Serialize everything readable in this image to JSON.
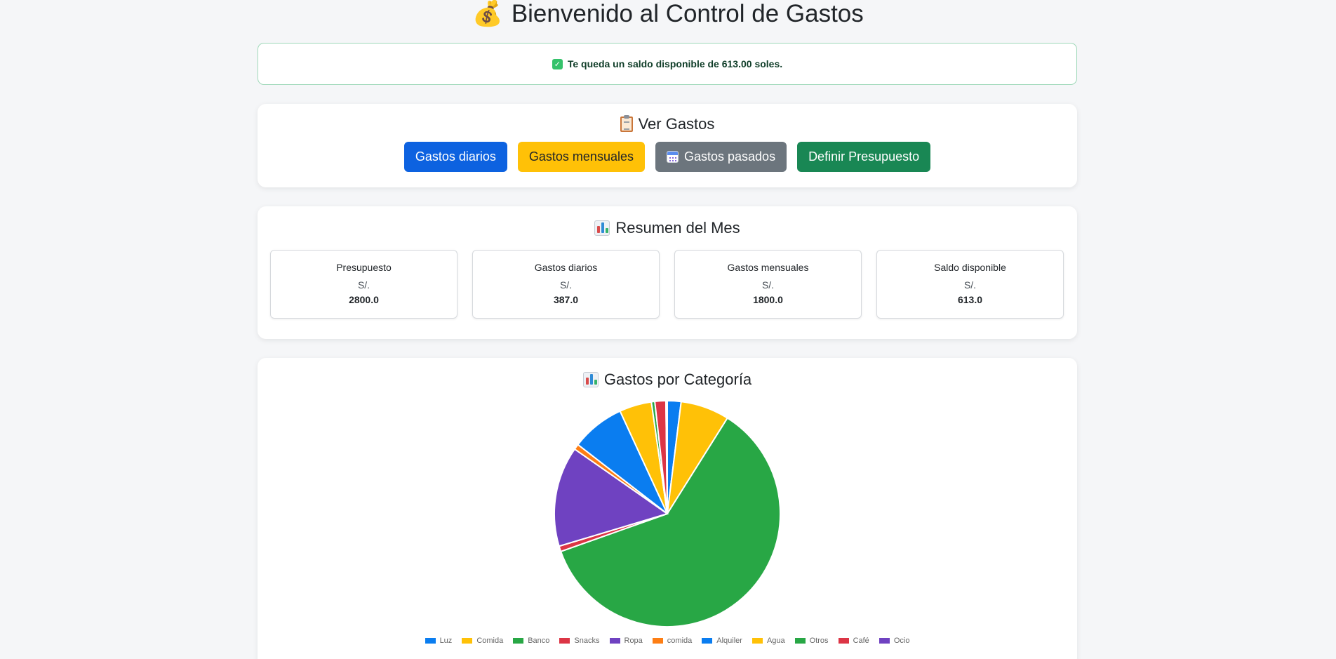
{
  "header": {
    "title": "Bienvenido al Control de Gastos",
    "title_icon": "money-bag-icon"
  },
  "alert": {
    "message": "Te queda un saldo disponible de 613.00 soles.",
    "icon": "check-icon",
    "check_glyph": "✓"
  },
  "ver_gastos": {
    "title": "Ver Gastos",
    "icon": "clipboard-icon",
    "buttons": {
      "diarios": "Gastos diarios",
      "mensuales": "Gastos mensuales",
      "pasados": "Gastos pasados",
      "presupuesto": "Definir Presupuesto"
    }
  },
  "resumen": {
    "title": "Resumen del Mes",
    "icon": "bar-chart-icon",
    "cards": [
      {
        "label": "Presupuesto",
        "currency": "S/.",
        "value": "2800.0"
      },
      {
        "label": "Gastos diarios",
        "currency": "S/.",
        "value": "387.0"
      },
      {
        "label": "Gastos mensuales",
        "currency": "S/.",
        "value": "1800.0"
      },
      {
        "label": "Saldo disponible",
        "currency": "S/.",
        "value": "613.0"
      }
    ]
  },
  "categorias": {
    "title": "Gastos por Categoría",
    "icon": "bar-chart-icon"
  },
  "chart_data": {
    "type": "pie",
    "title": "Gastos por Categoría",
    "legend_position": "bottom",
    "categories": [
      "Luz",
      "Comida",
      "Banco",
      "Snacks",
      "Ropa",
      "comida",
      "Alquiler",
      "Agua",
      "Otros",
      "Café",
      "Ocio"
    ],
    "values": [
      2.0,
      7.1,
      61.8,
      0.8,
      14.6,
      0.8,
      7.8,
      4.7,
      0.5,
      1.6,
      0.2
    ],
    "colors": [
      "#0a7df0",
      "#ffc107",
      "#28a745",
      "#dc3545",
      "#6f42c1",
      "#fd7e14",
      "#0a7df0",
      "#ffc107",
      "#28a745",
      "#dc3545",
      "#6f42c1"
    ]
  }
}
